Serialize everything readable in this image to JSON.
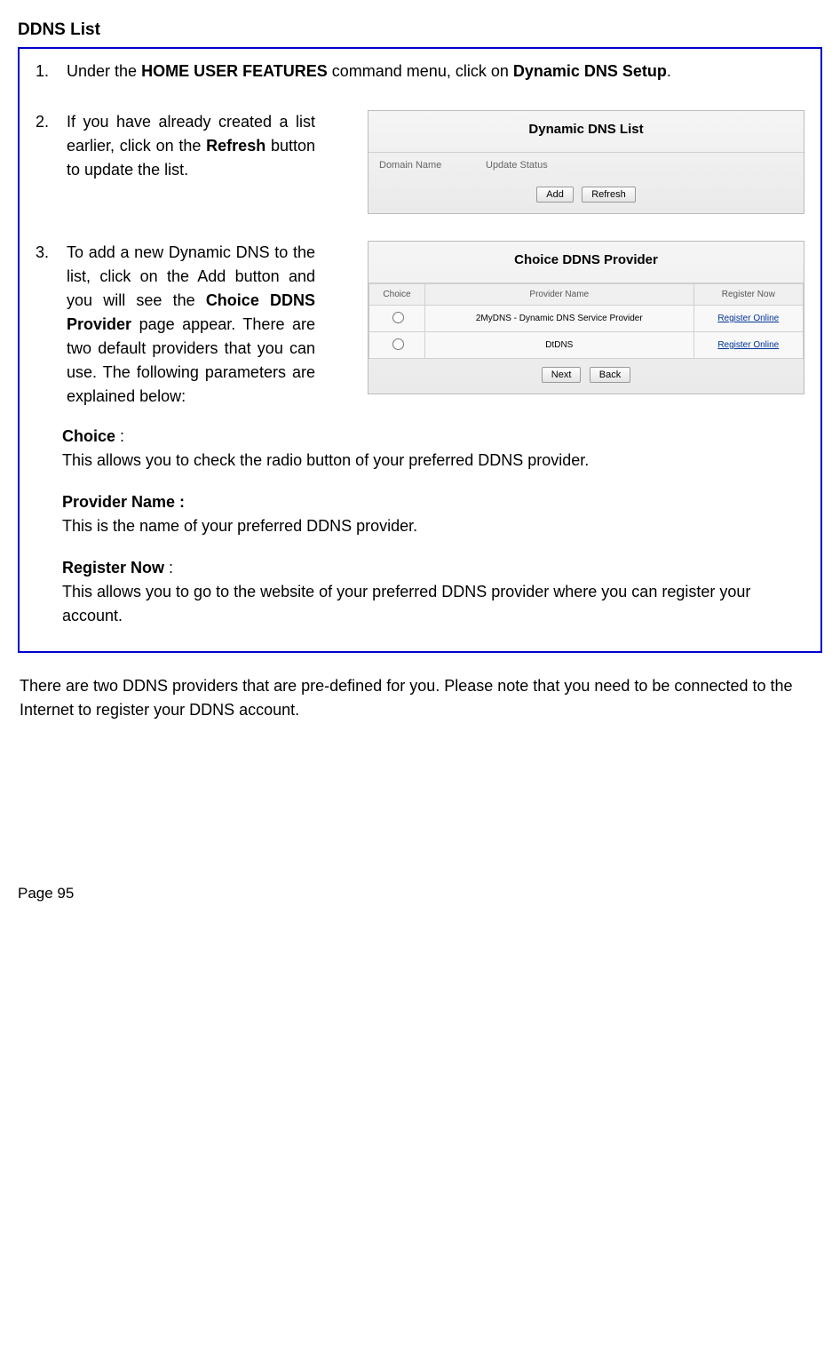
{
  "title": "DDNS List",
  "step1": {
    "num": "1.",
    "prefix": "Under the ",
    "bold1": "HOME USER FEATURES",
    "mid": " command menu, click on ",
    "bold2": "Dynamic DNS Setup",
    "suffix": "."
  },
  "step2": {
    "num": "2.",
    "prefix": "If you have already created a list earlier, click on the ",
    "bold": "Refresh",
    "suffix": " button to update the list."
  },
  "panel1": {
    "title": "Dynamic DNS List",
    "col1": "Domain Name",
    "col2": "Update Status",
    "btn_add": "Add",
    "btn_refresh": "Refresh"
  },
  "step3": {
    "num": "3.",
    "prefix": "To add a new Dynamic DNS to the list, click on the Add button and you will see the ",
    "bold": "Choice DDNS Provider",
    "suffix": " page appear. There are two default providers that you can use. The following parameters are explained below:"
  },
  "panel2": {
    "title": "Choice DDNS Provider",
    "col1": "Choice",
    "col2": "Provider Name",
    "col3": "Register Now",
    "row1_name": "2MyDNS - Dynamic DNS Service Provider",
    "row2_name": "DtDNS",
    "register": "Register Online",
    "btn_next": "Next",
    "btn_back": "Back"
  },
  "params": {
    "choice_label": "Choice",
    "choice_colon": " :",
    "choice_desc": "This allows you to check the radio button of your preferred DDNS provider.",
    "provider_label": "Provider Name :",
    "provider_desc": "This is the name of your preferred DDNS provider.",
    "register_label": "Register Now",
    "register_colon": " :",
    "register_desc": "This allows you to go to the website of your preferred DDNS provider where you can register your account."
  },
  "outside": "There are two DDNS providers that are pre-defined for you.   Please note that you need to be connected to the Internet to register your DDNS account.",
  "page": "Page 95"
}
